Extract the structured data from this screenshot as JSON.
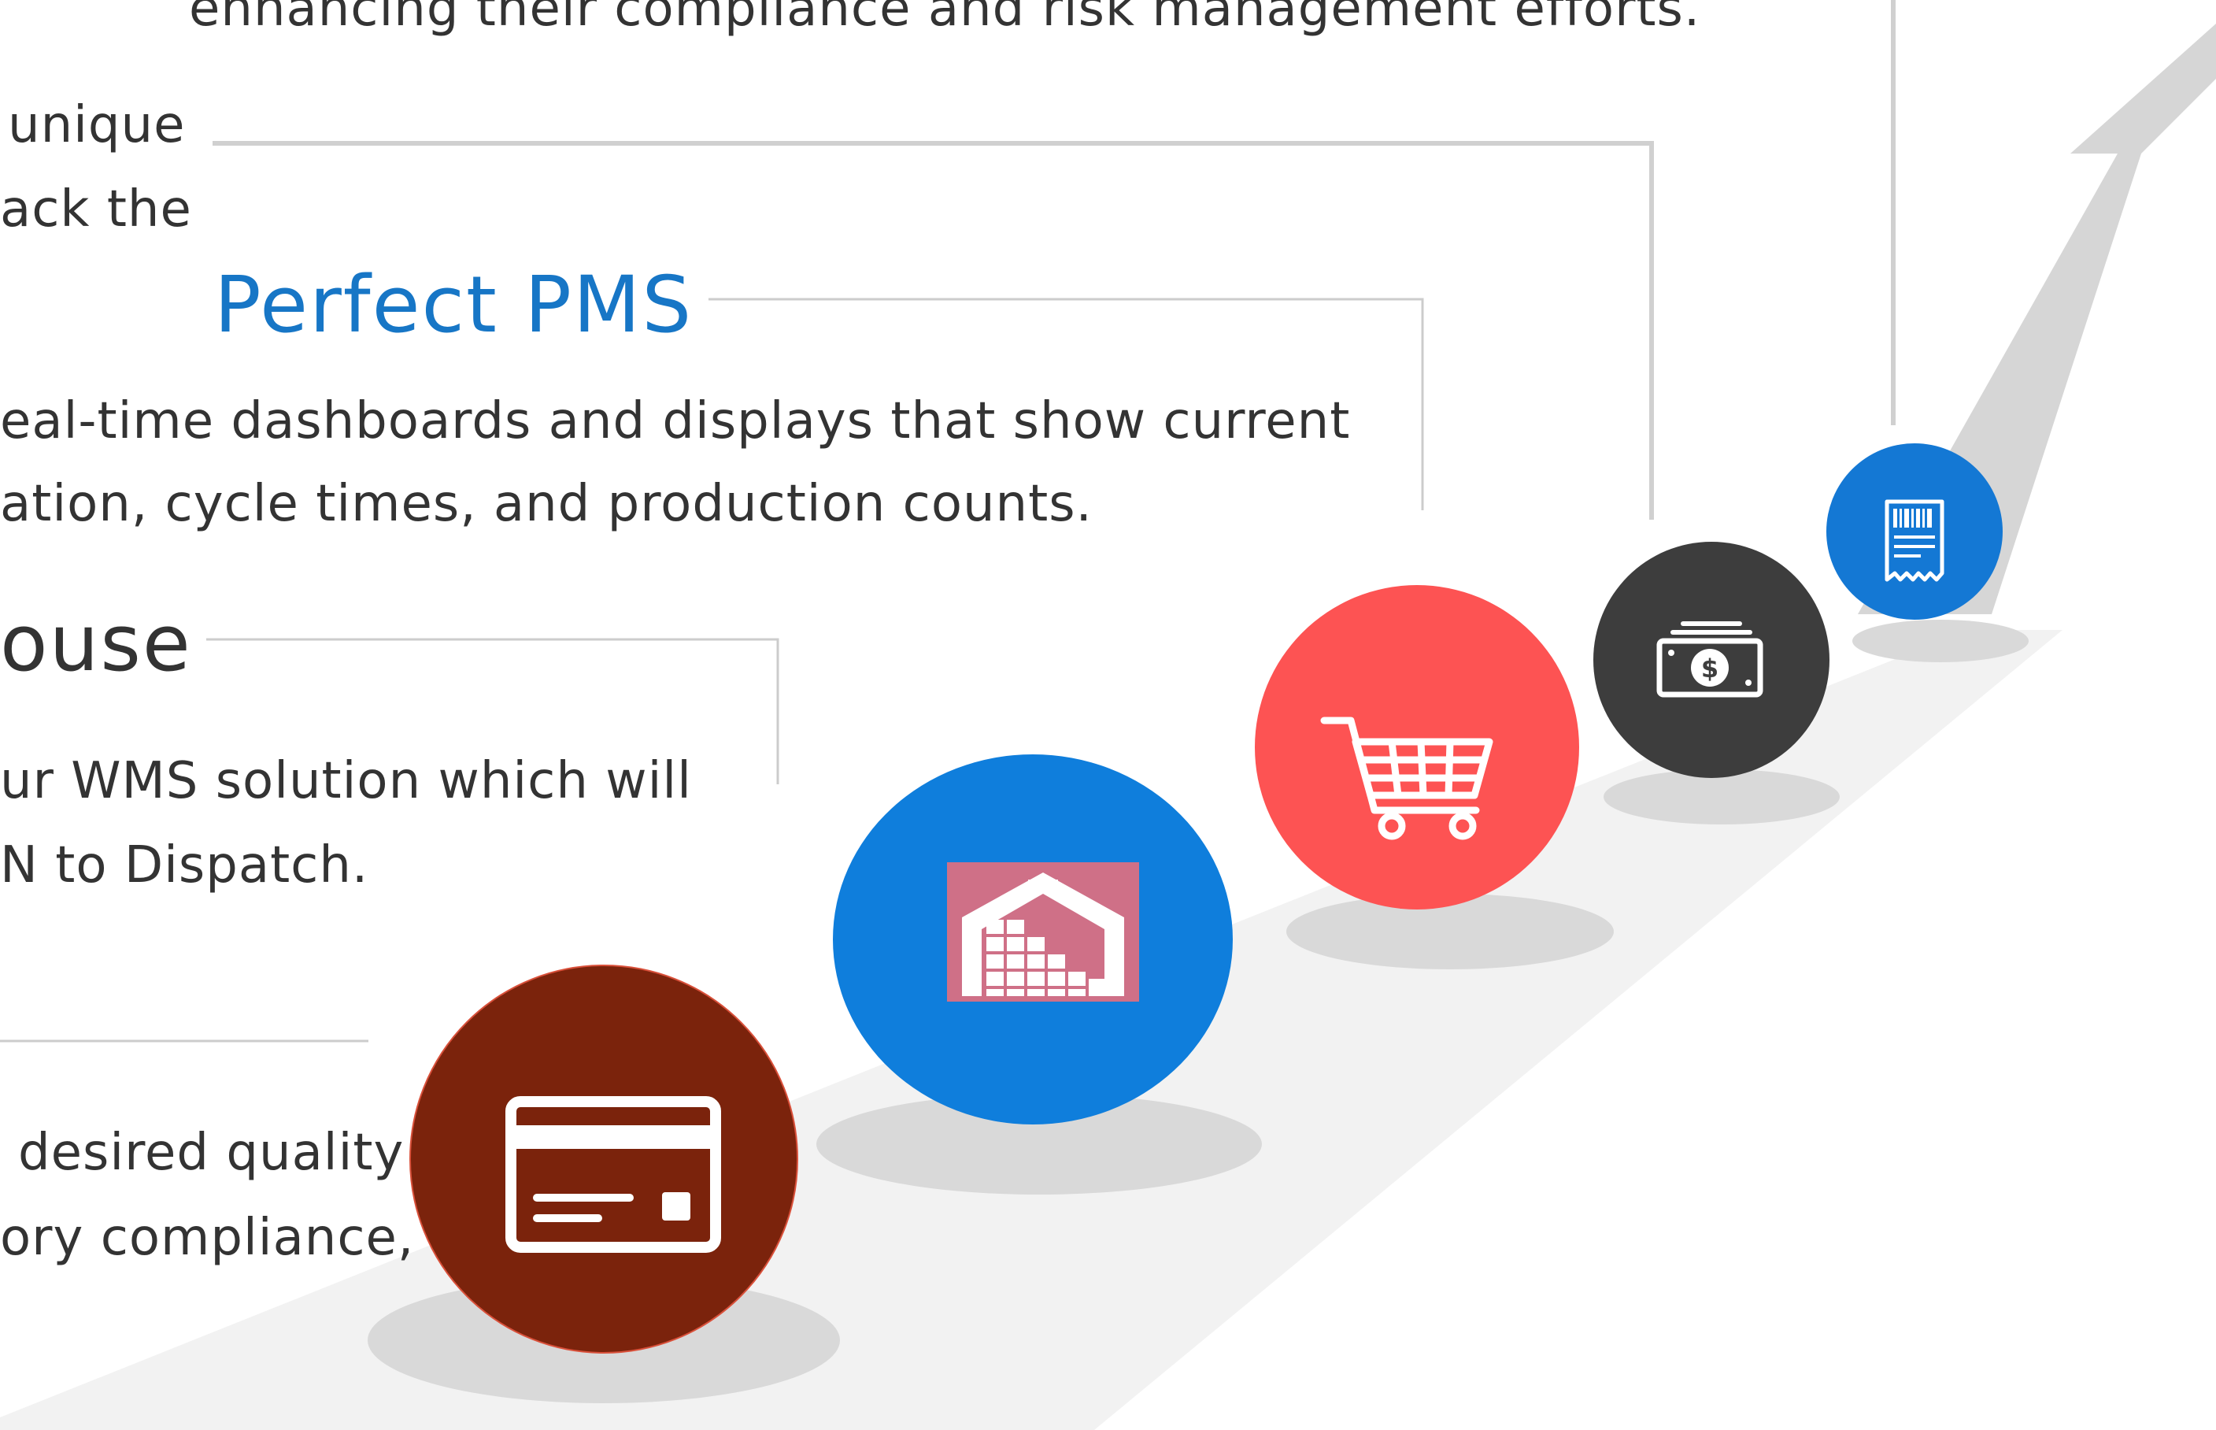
{
  "colors": {
    "heading_blue": "#1776c6",
    "text": "#333333",
    "connector": "#d0d0d0",
    "path": "#f2f2f2",
    "arrow": "#d6d6d6",
    "shadow": "#d9d9d9",
    "stage1": "#7b230c",
    "stage2": "#0f7edc",
    "stage3": "#fd5353",
    "stage4": "#3d3d3d",
    "stage5": "#1478d4",
    "icon_tile": "#cf7087",
    "icon": "#ffffff"
  },
  "text_blocks": {
    "top_line": "enhancing their compliance and risk management efforts.",
    "unique_line_1": "unique",
    "unique_line_2": "ack  the",
    "pms_heading": "Perfect PMS",
    "pms_line_1": "eal-time dashboards and displays that show current",
    "pms_line_2": "ation, cycle times, and production counts.",
    "warehouse_heading": "ouse",
    "wms_line_1": "ur WMS solution which will",
    "wms_line_2": "N to Dispatch.",
    "quality_line_1": "desired quality",
    "quality_line_2": "ory compliance,"
  },
  "stages": [
    {
      "id": "stage-1",
      "icon": "credit-card-icon",
      "color": "#7b230c"
    },
    {
      "id": "stage-2",
      "icon": "warehouse-icon",
      "color": "#0f7edc"
    },
    {
      "id": "stage-3",
      "icon": "shopping-cart-icon",
      "color": "#fd5353"
    },
    {
      "id": "stage-4",
      "icon": "money-icon",
      "color": "#3d3d3d"
    },
    {
      "id": "stage-5",
      "icon": "receipt-icon",
      "color": "#1478d4"
    }
  ]
}
